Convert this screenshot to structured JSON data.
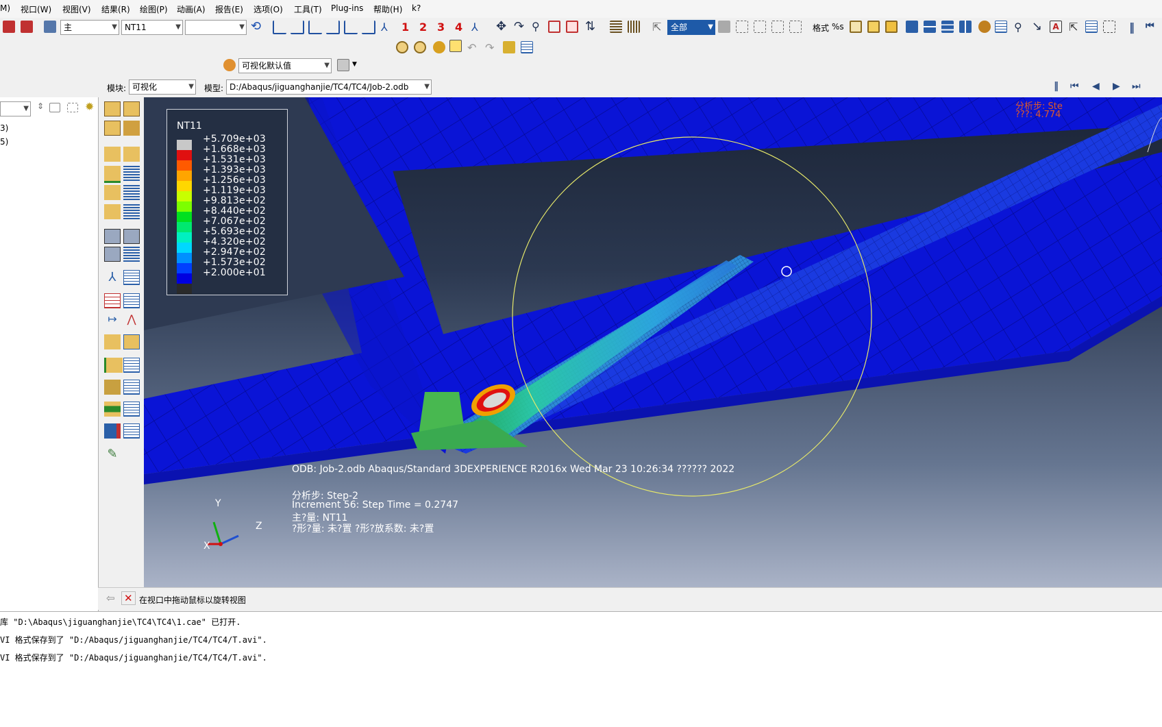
{
  "menu": {
    "items": [
      "M)",
      "视口(W)",
      "视图(V)",
      "结果(R)",
      "绘图(P)",
      "动画(A)",
      "报告(E)",
      "选项(O)",
      "工具(T)",
      "Plug-ins",
      "帮助(H)",
      "k?"
    ]
  },
  "toolbar": {
    "combo_main": "主",
    "combo_field": "NT11",
    "combo_empty": "",
    "view_numbers": [
      "1",
      "2",
      "3",
      "4"
    ],
    "selection_combo": "全部",
    "format_label": "格式",
    "format_percent": "%s",
    "visualization_defaults": "可视化默认值"
  },
  "module_row": {
    "module_label": "模块:",
    "module_value": "可视化",
    "model_label": "模型:",
    "model_value": "D:/Abaqus/jiguanghanjie/TC4/TC4/Job-2.odb"
  },
  "left_panel": {
    "lines": [
      "3)",
      "5)"
    ]
  },
  "legend": {
    "title": "NT11",
    "values": [
      "+5.709e+03",
      "+1.668e+03",
      "+1.531e+03",
      "+1.393e+03",
      "+1.256e+03",
      "+1.119e+03",
      "+9.813e+02",
      "+8.440e+02",
      "+7.067e+02",
      "+5.693e+02",
      "+4.320e+02",
      "+2.947e+02",
      "+1.573e+02",
      "+2.000e+01"
    ],
    "colors": [
      "#c8c8c8",
      "#e01010",
      "#ff5a00",
      "#ffa500",
      "#ffd700",
      "#c8ff00",
      "#7cff00",
      "#00e020",
      "#00e870",
      "#00f0c0",
      "#00d8ff",
      "#0090ff",
      "#0040ff",
      "#0000e0",
      "#2a2a2a"
    ]
  },
  "viewport": {
    "step_corner": "分析步: Ste",
    "step_corner2": "???: 4.774",
    "odb_line": "ODB: Job-2.odb     Abaqus/Standard 3DEXPERIENCE R2016x     Wed Mar 23 10:26:34 ?????? 2022",
    "step_line": "分析步: Step-2",
    "increment_line": "Increment     56: Step Time =    0.2747",
    "primary_line": "主?量: NT11",
    "deform_line": "?形?量: 未?置   ?形?放系数: 未?置",
    "axis_x": "X",
    "axis_y": "Y",
    "axis_z": "Z"
  },
  "prompt": {
    "text": "在视口中拖动鼠标以旋转视图"
  },
  "messages": [
    "库 \"D:\\Abaqus\\jiguanghanjie\\TC4\\TC4\\1.cae\" 已打开.",
    "VI 格式保存到了 \"D:/Abaqus/jiguanghanjie/TC4/TC4/T.avi\".",
    "VI 格式保存到了 \"D:/Abaqus/jiguanghanjie/TC4/TC4/T.avi\"."
  ]
}
